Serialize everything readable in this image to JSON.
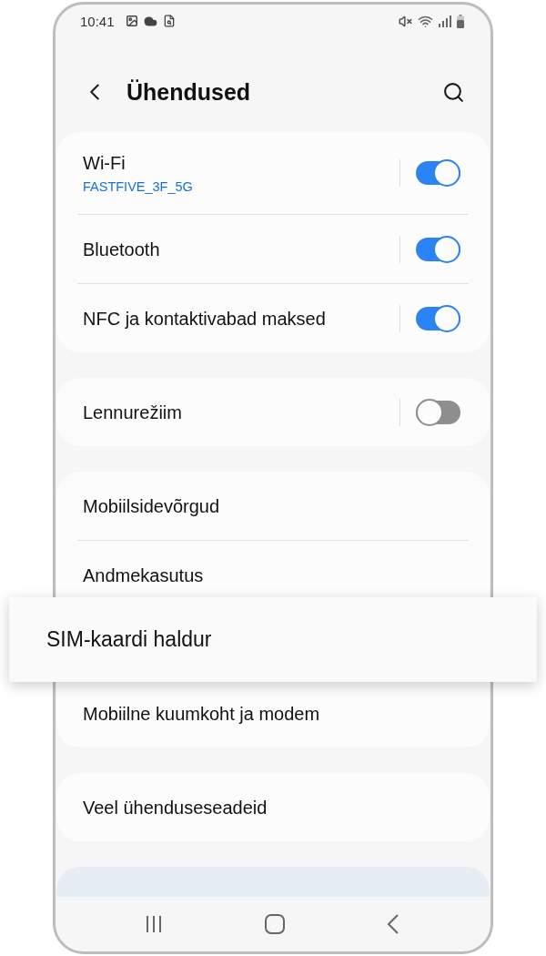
{
  "status_bar": {
    "time": "10:41"
  },
  "header": {
    "title": "Ühendused"
  },
  "groups": [
    {
      "items": [
        {
          "kind": "toggle",
          "label": "Wi-Fi",
          "subtitle": "FASTFIVE_3F_5G",
          "on": true,
          "highlighted": false
        },
        {
          "kind": "toggle",
          "label": "Bluetooth",
          "on": true,
          "highlighted": false
        },
        {
          "kind": "toggle",
          "label": "NFC ja kontaktivabad maksed",
          "on": true,
          "highlighted": false
        }
      ]
    },
    {
      "items": [
        {
          "kind": "toggle",
          "label": "Lennurežiim",
          "on": false,
          "highlighted": false
        }
      ]
    },
    {
      "items": [
        {
          "kind": "link",
          "label": "Mobiilsidevõrgud",
          "highlighted": false
        },
        {
          "kind": "link",
          "label": "Andmekasutus",
          "highlighted": false
        },
        {
          "kind": "link",
          "label": "SIM-kaardi haldur",
          "highlighted": true
        },
        {
          "kind": "link",
          "label": "Mobiilne kuumkoht ja modem",
          "highlighted": false
        }
      ]
    },
    {
      "items": [
        {
          "kind": "link",
          "label": "Veel ühenduseseadeid",
          "highlighted": false
        }
      ]
    }
  ]
}
